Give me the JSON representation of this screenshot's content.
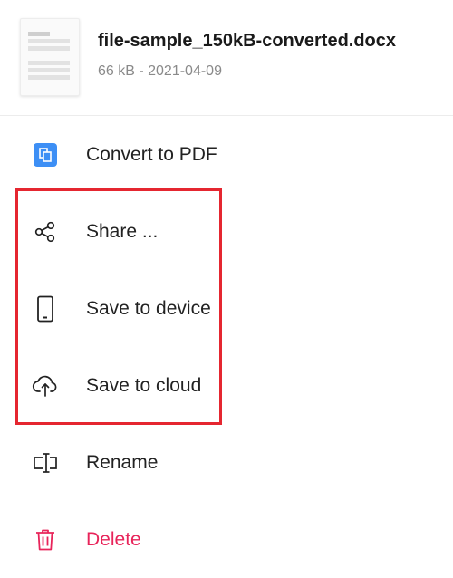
{
  "file": {
    "name": "file-sample_150kB-converted.docx",
    "meta": "66 kB - 2021-04-09"
  },
  "menu": {
    "items": [
      {
        "label": "Convert to PDF",
        "icon": "convert-pdf-icon"
      },
      {
        "label": "Share ...",
        "icon": "share-icon"
      },
      {
        "label": "Save to device",
        "icon": "phone-icon"
      },
      {
        "label": "Save to cloud",
        "icon": "cloud-upload-icon"
      },
      {
        "label": "Rename",
        "icon": "rename-icon"
      },
      {
        "label": "Delete",
        "icon": "trash-icon"
      }
    ]
  },
  "colors": {
    "accent_blue": "#3d8ff5",
    "danger": "#e8245a",
    "highlight_box": "#e52630",
    "text": "#222222",
    "muted": "#8a8a8a"
  }
}
